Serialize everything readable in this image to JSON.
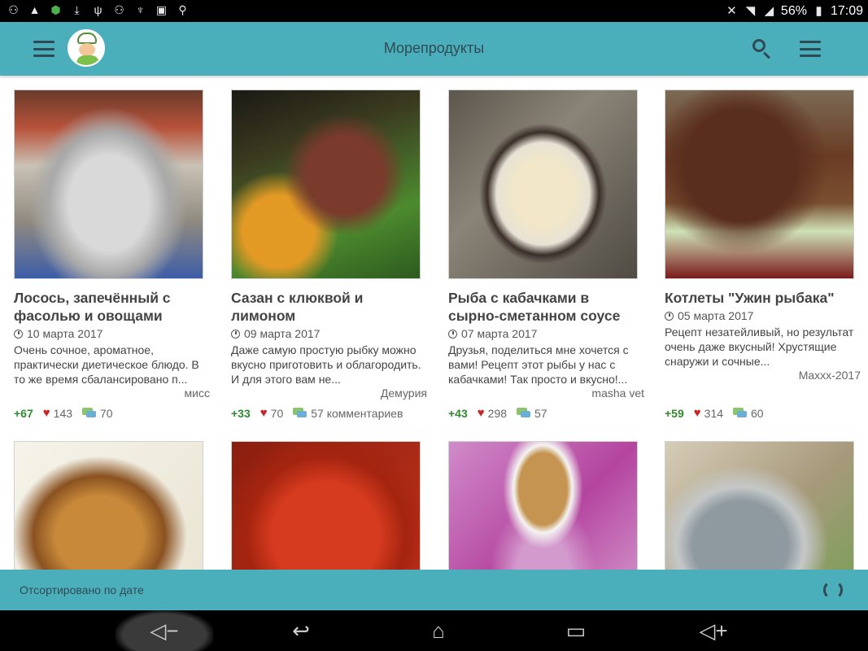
{
  "status_bar": {
    "left_icons": [
      "usb-debug-icon",
      "warning-icon",
      "shield-app-icon",
      "download-icon",
      "usb-icon",
      "usb-icon",
      "usb-icon",
      "image-icon",
      "search-icon"
    ],
    "battery": "56%",
    "time": "17:09"
  },
  "app_bar": {
    "title": "Морепродукты"
  },
  "recipes": [
    {
      "title": "Лосось, запечённый с фасолью и овощами",
      "date": "10 марта 2017",
      "description": "Очень сочное, ароматное, практически диетическое блюдо. В то же время сбалансировано п...",
      "author": "мисс",
      "rating": "+67",
      "likes": "143",
      "comments": "70"
    },
    {
      "title": "Сазан с клюквой и лимоном",
      "date": "09 марта 2017",
      "description": "Даже самую простую рыбку можно вкусно приготовить и облагородить. И для этого вам не...",
      "author": "Демурия",
      "rating": "+33",
      "likes": "70",
      "comments": "57 комментариев"
    },
    {
      "title": "Рыба с кабачками в сырно-сметанном соусе",
      "date": "07 марта 2017",
      "description": "Друзья, поделиться мне хочется с вами! Рецепт этот рыбы у нас с кабачками! Так просто и вкусно!...",
      "author": "masha vet",
      "rating": "+43",
      "likes": "298",
      "comments": "57"
    },
    {
      "title": "Котлеты \"Ужин рыбака\"",
      "date": "05 марта 2017",
      "description": "Рецепт незатейливый, но результат очень даже вкусный! Хрустящие снаружи и сочные...",
      "author": "Maxxx-2017",
      "rating": "+59",
      "likes": "314",
      "comments": "60"
    }
  ],
  "sort_bar": {
    "label": "Отсортировано по дате"
  },
  "colors": {
    "accent": "#4aafbb",
    "icon_dark": "#2f4a55",
    "rating_green": "#2e8a2e",
    "heart_red": "#c62828"
  }
}
